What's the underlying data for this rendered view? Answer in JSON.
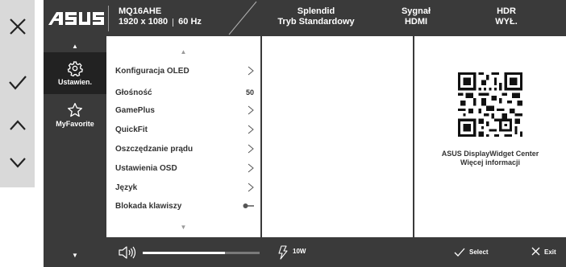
{
  "rail": {
    "buttons": [
      {
        "name": "close-icon"
      },
      {
        "name": "check-icon"
      },
      {
        "name": "chevron-up-icon"
      },
      {
        "name": "chevron-down-icon"
      }
    ]
  },
  "header": {
    "brand": "ASUS",
    "model": "MQ16AHE",
    "resolution": "1920 x 1080",
    "refresh": "60 Hz",
    "splendid_label": "Splendid",
    "splendid_value": "Tryb Standardowy",
    "signal_label": "Sygnał",
    "signal_value": "HDMI",
    "hdr_label": "HDR",
    "hdr_value": "WYŁ."
  },
  "categories": [
    {
      "label": "Ustawien.",
      "icon": "gear-icon",
      "active": true
    },
    {
      "label": "MyFavorite",
      "icon": "star-icon",
      "active": false
    }
  ],
  "menu": {
    "items": [
      {
        "label": "Konfiguracja OLED",
        "value": "",
        "control": "chevron"
      },
      {
        "label": "Głośność",
        "value": "50",
        "control": "value"
      },
      {
        "label": "GamePlus",
        "value": "",
        "control": "chevron"
      },
      {
        "label": "QuickFit",
        "value": "",
        "control": "chevron"
      },
      {
        "label": "Oszczędzanie prądu",
        "value": "",
        "control": "chevron"
      },
      {
        "label": "Ustawienia OSD",
        "value": "",
        "control": "chevron"
      },
      {
        "label": "Język",
        "value": "",
        "control": "chevron"
      },
      {
        "label": "Blokada klawiszy",
        "value": "",
        "control": "toggle"
      }
    ]
  },
  "info": {
    "title": "ASUS DisplayWidget Center",
    "link": "Więcej informacji"
  },
  "footer": {
    "volume_level": 0.7,
    "power": "10W",
    "select_label": "Select",
    "exit_label": "Exit"
  },
  "colors": {
    "panel_dark": "#3a3a3a",
    "panel_active": "#222222",
    "content_bg": "#ffffff",
    "rail_bg": "#d9d9d9",
    "text_dark": "#333333"
  }
}
